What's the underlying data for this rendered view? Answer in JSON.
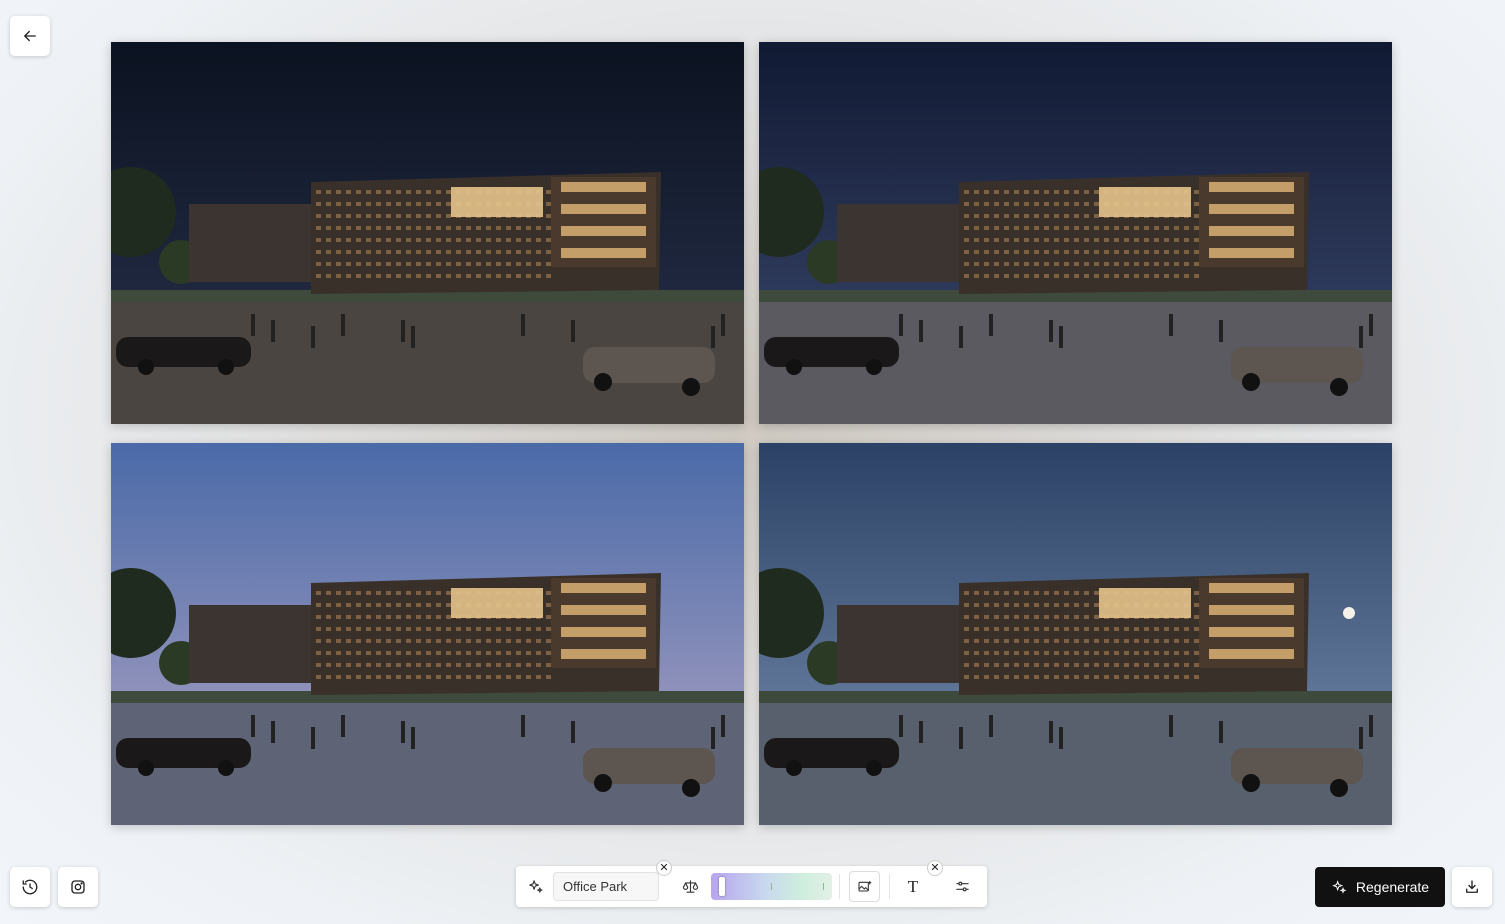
{
  "nav": {
    "back_icon": "arrow-left-icon"
  },
  "tiles": [
    {
      "id": "night",
      "sky_top": "#0b1220",
      "sky_bottom": "#2a3350",
      "ground": "#4a4540"
    },
    {
      "id": "starry-night",
      "sky_top": "#111a33",
      "sky_bottom": "#3d4a70",
      "ground": "#5a5a60"
    },
    {
      "id": "dusk",
      "sky_top": "#4a6aa8",
      "sky_bottom": "#b2a6c4",
      "ground": "#5e6375"
    },
    {
      "id": "moonlit-rain",
      "sky_top": "#2b4266",
      "sky_bottom": "#7a8fb0",
      "ground": "#58606e"
    }
  ],
  "toolbar": {
    "style_label": "Office Park",
    "slider_value": 0.05,
    "text_icon_glyph": "T"
  },
  "actions": {
    "regenerate_label": "Regenerate",
    "history_icon": "history-icon",
    "instagram_icon": "instagram-icon",
    "download_icon": "download-icon"
  },
  "colors": {
    "accent": "#111111",
    "surface": "#ffffff"
  }
}
